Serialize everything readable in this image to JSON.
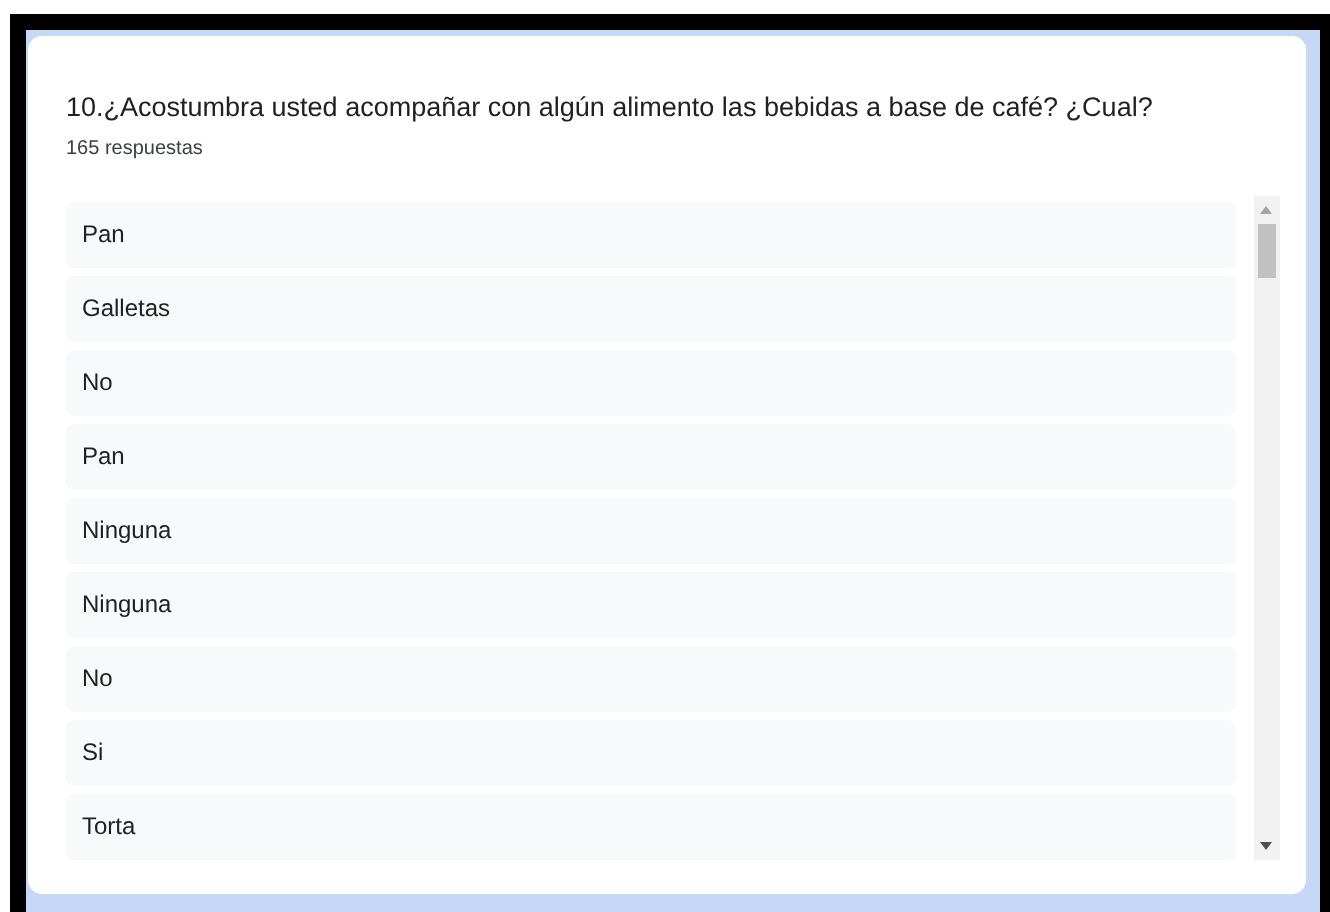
{
  "question": {
    "title": "10.¿Acostumbra usted acompañar con algún alimento las bebidas a base de café? ¿Cual?",
    "count": "165 respuestas"
  },
  "responses": [
    "Pan",
    "Galletas",
    "No",
    "Pan",
    "Ninguna",
    "Ninguna",
    "No",
    "Si",
    "Torta"
  ]
}
